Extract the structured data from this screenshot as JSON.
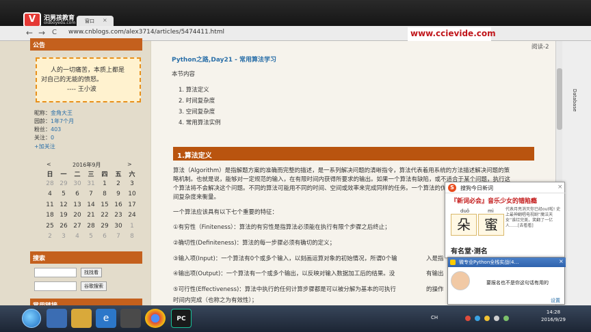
{
  "browser": {
    "tab_label": "窗口",
    "tab_close": "×",
    "url": "www.cnblogs.com/alex3714/articles/5474411.html",
    "back": "←",
    "forward": "→",
    "reload": "C"
  },
  "logo": {
    "mark": "V",
    "title": "汩男孩教育",
    "url": "oldboyedu.com"
  },
  "watermark": "www.ccievide.com",
  "sidebar": {
    "notice_title": "公告",
    "quote_line1": "人的一切痛苦，本质上都是",
    "quote_line2": "对自己的无能的愤怒。",
    "quote_author": "---- 王小波",
    "profile": [
      {
        "label": "昵称：",
        "value": "金角大王"
      },
      {
        "label": "园龄：",
        "value": "1年7个月"
      },
      {
        "label": "粉丝：",
        "value": "403"
      },
      {
        "label": "关注：",
        "value": "0"
      }
    ],
    "follow": "+加关注",
    "calendar": {
      "prev": "<",
      "month": "2016年9月",
      "next": ">",
      "weekdays": [
        "日",
        "一",
        "二",
        "三",
        "四",
        "五",
        "六"
      ],
      "weeks": [
        [
          "28",
          "29",
          "30",
          "31",
          "1",
          "2",
          "3"
        ],
        [
          "4",
          "5",
          "6",
          "7",
          "8",
          "9",
          "10"
        ],
        [
          "11",
          "12",
          "13",
          "14",
          "15",
          "16",
          "17"
        ],
        [
          "18",
          "19",
          "20",
          "21",
          "22",
          "23",
          "24"
        ],
        [
          "25",
          "26",
          "27",
          "28",
          "29",
          "30",
          "1"
        ],
        [
          "2",
          "3",
          "4",
          "5",
          "6",
          "7",
          "8"
        ]
      ]
    },
    "search_title": "搜索",
    "search_btn1": "找找看",
    "search_btn2": "谷歌搜索",
    "common_links": "常用链接"
  },
  "article": {
    "top_right": "阅读-2",
    "title": "Python之路,Day21 - 常用算法学习",
    "toc_heading": "本节内容",
    "toc": [
      "1.  算法定义",
      "2.  时间复杂度",
      "3.  空间复杂度",
      "4.  常用算法实例"
    ],
    "section_title": "1.算法定义",
    "para1_l1": "算法（Algorithm）是指解题方案的准确而完整的描述，是一系列解决问题的清晰指令，算法代表着用系统的方法描述解决问题的策",
    "para1_l2": "略机制。也就是说，能够对一定规范的输入，在有限时间内获得所要求的输出。如果一个算法有缺陷，或不适合于某个问题，执行这",
    "para1_l3": "个算法将不会解决这个问题。不同的算法可能用不同的时间、空间或效率来完成同样的任务。一个算法的优劣可以用空间复杂度与时",
    "para1_l4": "间复杂度来衡量。",
    "para2": "一个算法应该具有以下七个重要的特征：",
    "feat1": "①有穷性（Finiteness）：算法的有穷性是指算法必须能在执行有限个步骤之后终止；",
    "feat2": "②确切性(Definiteness)：算法的每一步骤必须有确切的定义；",
    "feat3": "③输入项(Input)：一个算法有0个或多个输入，以刻画运算对象的初始情况，所谓0个输",
    "feat3_tail": "入是指",
    "feat4": "④输出项(Output)：一个算法有一个或多个输出，以反映对输入数据加工后的结果。没",
    "feat4_tail": "有输出",
    "feat5": "⑤可行性(Effectiveness)：算法中执行的任何计算步骤都是可以被分解为基本的可执行",
    "feat5_tail": "的操作",
    "feat5_l2": "时间内完成（也称之为有效性）；"
  },
  "right_panel": {
    "label": "Database"
  },
  "sogou": {
    "header": "搜狗今日新词",
    "close": "×",
    "logo": "S",
    "title": "『新词必会』音乐少女的错陷瘾",
    "pin1": "duǒ",
    "pin2": "mì",
    "char1": "朵",
    "char2": "蜜",
    "desc": "代表月亮消灭你已经out啦! 史上最神翻唱电视剧“魔法天女”谁红完美，笑翻了一亿人……[去看看]",
    "footer": "有名堂·测名"
  },
  "qq": {
    "header": "微专业Python全栈实战(4…",
    "close": "×",
    "message": "要报名也不是你这句话有用的",
    "settings": "设置"
  },
  "taskbar": {
    "icons": [
      "IE",
      "文件夹",
      "媒体",
      "Chrome",
      "PyCharm"
    ],
    "tray": "CH",
    "time": "14:28",
    "date": "2016/9/29"
  }
}
